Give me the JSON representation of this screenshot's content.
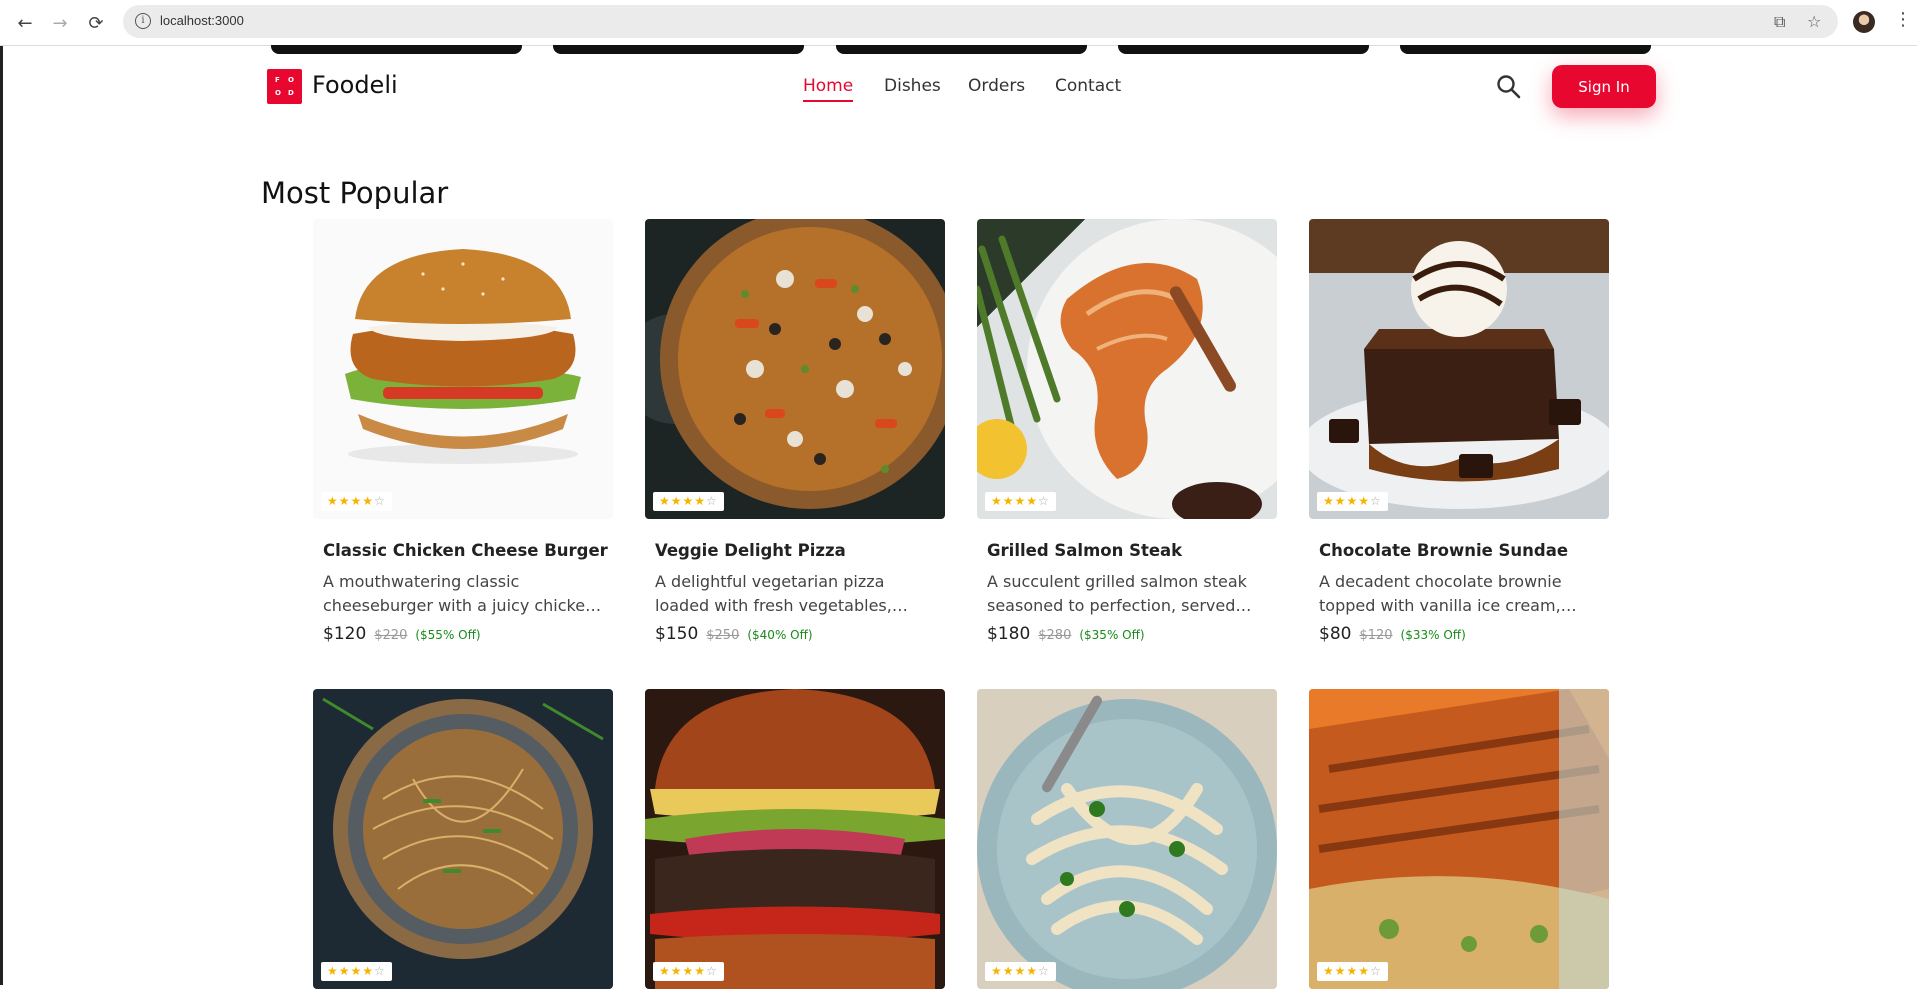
{
  "browser": {
    "url": "localhost:3000"
  },
  "site": {
    "brand": "Foodeli",
    "logo_letters": [
      "F",
      "O",
      "O",
      "D"
    ]
  },
  "nav": {
    "items": [
      {
        "label": "Home",
        "active": true
      },
      {
        "label": "Dishes",
        "active": false
      },
      {
        "label": "Orders",
        "active": false
      },
      {
        "label": "Contact",
        "active": false
      }
    ],
    "signin_label": "Sign In"
  },
  "section": {
    "title": "Most Popular"
  },
  "cards": [
    {
      "name": "Classic Chicken Cheese Burger",
      "desc": "A mouthwatering classic cheeseburger with a juicy chicken patty",
      "price": "$120",
      "old_price": "$220",
      "off": "($55% Off)",
      "rating": 4
    },
    {
      "name": "Veggie Delight Pizza",
      "desc": "A delightful vegetarian pizza loaded with fresh vegetables, olives and cheese",
      "price": "$150",
      "old_price": "$250",
      "off": "($40% Off)",
      "rating": 4
    },
    {
      "name": "Grilled Salmon Steak",
      "desc": "A succulent grilled salmon steak seasoned to perfection, served with greens",
      "price": "$180",
      "old_price": "$280",
      "off": "($35% Off)",
      "rating": 4
    },
    {
      "name": "Chocolate Brownie Sundae",
      "desc": "A decadent chocolate brownie topped with vanilla ice cream, chocolate sauce",
      "price": "$80",
      "old_price": "$120",
      "off": "($33% Off)",
      "rating": 4
    },
    {
      "name": "",
      "desc": "",
      "price": "",
      "old_price": "",
      "off": "",
      "rating": 4
    },
    {
      "name": "",
      "desc": "",
      "price": "",
      "old_price": "",
      "off": "",
      "rating": 4
    },
    {
      "name": "",
      "desc": "",
      "price": "",
      "old_price": "",
      "off": "",
      "rating": 4
    },
    {
      "name": "",
      "desc": "",
      "price": "",
      "old_price": "",
      "off": "",
      "rating": 4
    }
  ],
  "colors": {
    "accent": "#e8072f",
    "discount": "#1a8a1a",
    "star": "#f4b400"
  }
}
